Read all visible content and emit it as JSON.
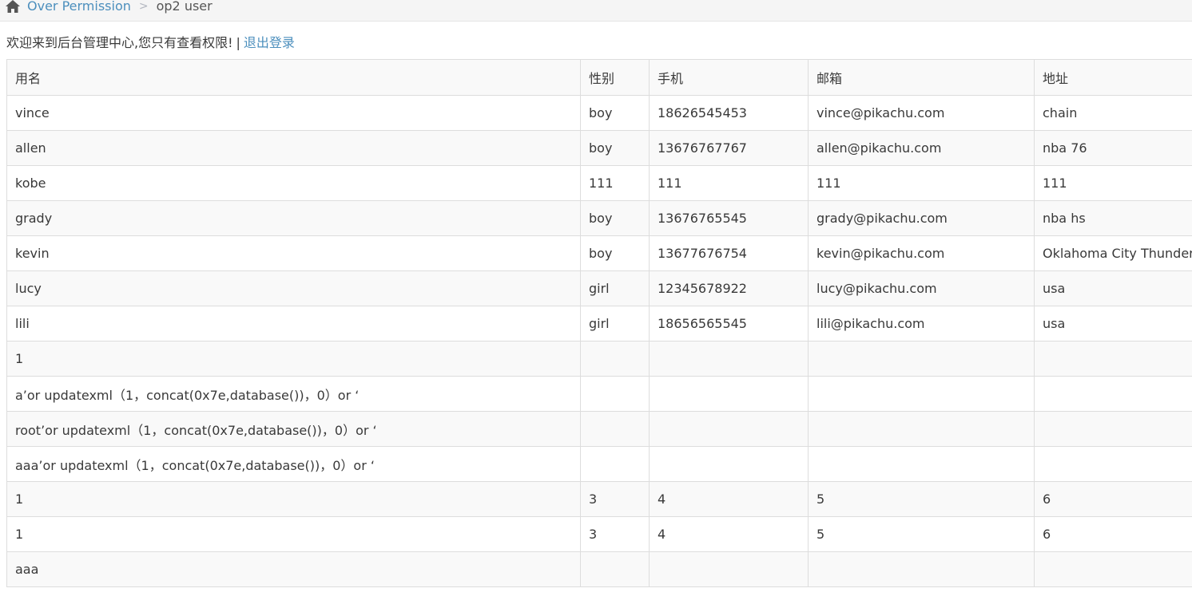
{
  "breadcrumb": {
    "home_icon": "home-icon",
    "link_label": "Over Permission",
    "separator": ">",
    "current_label": "op2 user"
  },
  "welcome": {
    "message": "欢迎来到后台管理中心,您只有查看权限!",
    "pipe": "|",
    "logout_label": "退出登录"
  },
  "table": {
    "headers": [
      "用名",
      "性别",
      "手机",
      "邮箱",
      "地址"
    ],
    "rows": [
      [
        "vince",
        "boy",
        "18626545453",
        "vince@pikachu.com",
        "chain"
      ],
      [
        "allen",
        "boy",
        "13676767767",
        "allen@pikachu.com",
        "nba 76"
      ],
      [
        "kobe",
        "111",
        "111",
        "111",
        "111"
      ],
      [
        "grady",
        "boy",
        "13676765545",
        "grady@pikachu.com",
        "nba hs"
      ],
      [
        "kevin",
        "boy",
        "13677676754",
        "kevin@pikachu.com",
        "Oklahoma City Thunder"
      ],
      [
        "lucy",
        "girl",
        "12345678922",
        "lucy@pikachu.com",
        "usa"
      ],
      [
        "lili",
        "girl",
        "18656565545",
        "lili@pikachu.com",
        "usa"
      ],
      [
        "1",
        "",
        "",
        "",
        ""
      ],
      [
        "a’or updatexml（1，concat(0x7e,database())，0）or ‘",
        "",
        "",
        "",
        ""
      ],
      [
        "root’or updatexml（1，concat(0x7e,database())，0）or ‘",
        "",
        "",
        "",
        ""
      ],
      [
        "aaa’or updatexml（1，concat(0x7e,database())，0）or ‘",
        "",
        "",
        "",
        ""
      ],
      [
        "1",
        "3",
        "4",
        "5",
        "6"
      ],
      [
        "1",
        "3",
        "4",
        "5",
        "6"
      ],
      [
        "aaa",
        "",
        "",
        "",
        ""
      ]
    ]
  },
  "colors": {
    "link": "#4c8fbd",
    "border": "#dddddd",
    "stripe": "#f9f9f9"
  }
}
